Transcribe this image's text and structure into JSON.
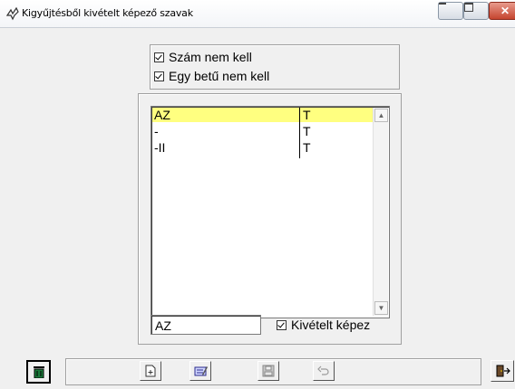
{
  "window": {
    "title": "Kigyűjtésből kivételt képező szavak"
  },
  "options": {
    "no_number": "Szám nem kell",
    "no_single_letter": "Egy betű nem kell"
  },
  "list": {
    "rows": [
      {
        "word": "AZ",
        "flag": "T",
        "selected": true
      },
      {
        "word": "-",
        "flag": "T",
        "selected": false
      },
      {
        "word": "-II",
        "flag": "T",
        "selected": false
      }
    ]
  },
  "edit": {
    "word_value": "AZ",
    "exception_label": "Kivételt képez"
  },
  "icons": {
    "app": "app-bird-icon",
    "trash": "trash-icon",
    "new": "new-document-icon",
    "edit": "edit-pencil-icon",
    "save": "save-disk-icon",
    "undo": "undo-icon",
    "exit": "exit-door-icon"
  },
  "colors": {
    "selection": "#ffff80",
    "trash_icon": "#1a7a3a",
    "edit_icon": "#2b2b8c"
  }
}
